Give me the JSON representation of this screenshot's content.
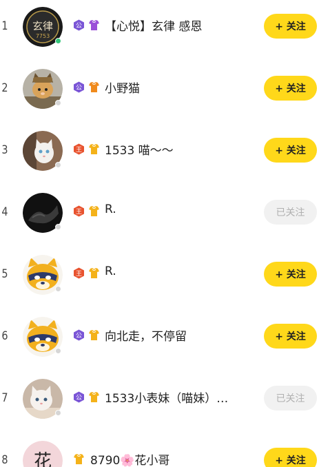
{
  "rows": [
    {
      "rank": "1",
      "name": "【心悦】玄律 感恩",
      "button": "+ 关注",
      "followed": false,
      "online": true,
      "badges": [
        "gong-purple",
        "vest-purple"
      ],
      "avatar": "xuanlv-logo"
    },
    {
      "rank": "2",
      "name": "小野猫",
      "button": "+ 关注",
      "followed": false,
      "online": false,
      "badges": [
        "gong-purple",
        "vest-orange"
      ],
      "avatar": "cat-in-costume"
    },
    {
      "rank": "3",
      "name": "1533 喵～～",
      "button": "+ 关注",
      "followed": false,
      "online": false,
      "badges": [
        "wang-red",
        "vest-gold"
      ],
      "avatar": "white-kitten"
    },
    {
      "rank": "4",
      "name": "R.",
      "button": "已关注",
      "followed": true,
      "online": false,
      "badges": [
        "wang-red",
        "vest-gold"
      ],
      "avatar": "dark-photo"
    },
    {
      "rank": "5",
      "name": "R.",
      "button": "+ 关注",
      "followed": false,
      "online": false,
      "badges": [
        "wang-red",
        "vest-gold"
      ],
      "avatar": "raccoon-mascot"
    },
    {
      "rank": "6",
      "name": "向北走，不停留",
      "button": "+ 关注",
      "followed": false,
      "online": false,
      "badges": [
        "gong-purple",
        "vest-gold"
      ],
      "avatar": "raccoon-mascot"
    },
    {
      "rank": "7",
      "name": "1533小表妹（喵妹）…",
      "button": "已关注",
      "followed": true,
      "online": false,
      "badges": [
        "gong-purple",
        "vest-gold"
      ],
      "avatar": "white-kitten-2"
    },
    {
      "rank": "8",
      "name": "8790🌸花小哥",
      "button": "+ 关注",
      "followed": false,
      "online": false,
      "badges": [
        "vest-gold"
      ],
      "avatar": "hua-calligraphy"
    }
  ],
  "badge_text": {
    "gong": "公",
    "wang": "王"
  },
  "avatar_text": {
    "xuanlv": "玄律",
    "xuanlv_num": "7753",
    "hua": "花"
  },
  "colors": {
    "follow_button": "#ffd81a",
    "followed_button": "#f1f1f1",
    "online_dot": "#35c67a",
    "offline_dot": "#d6d6d6",
    "gong_badge": "#7a55d6",
    "wang_badge": "#e8532f",
    "vest_gold": "#f4b21a",
    "vest_purple": "#9b4fd8",
    "vest_orange": "#f08a1c"
  }
}
